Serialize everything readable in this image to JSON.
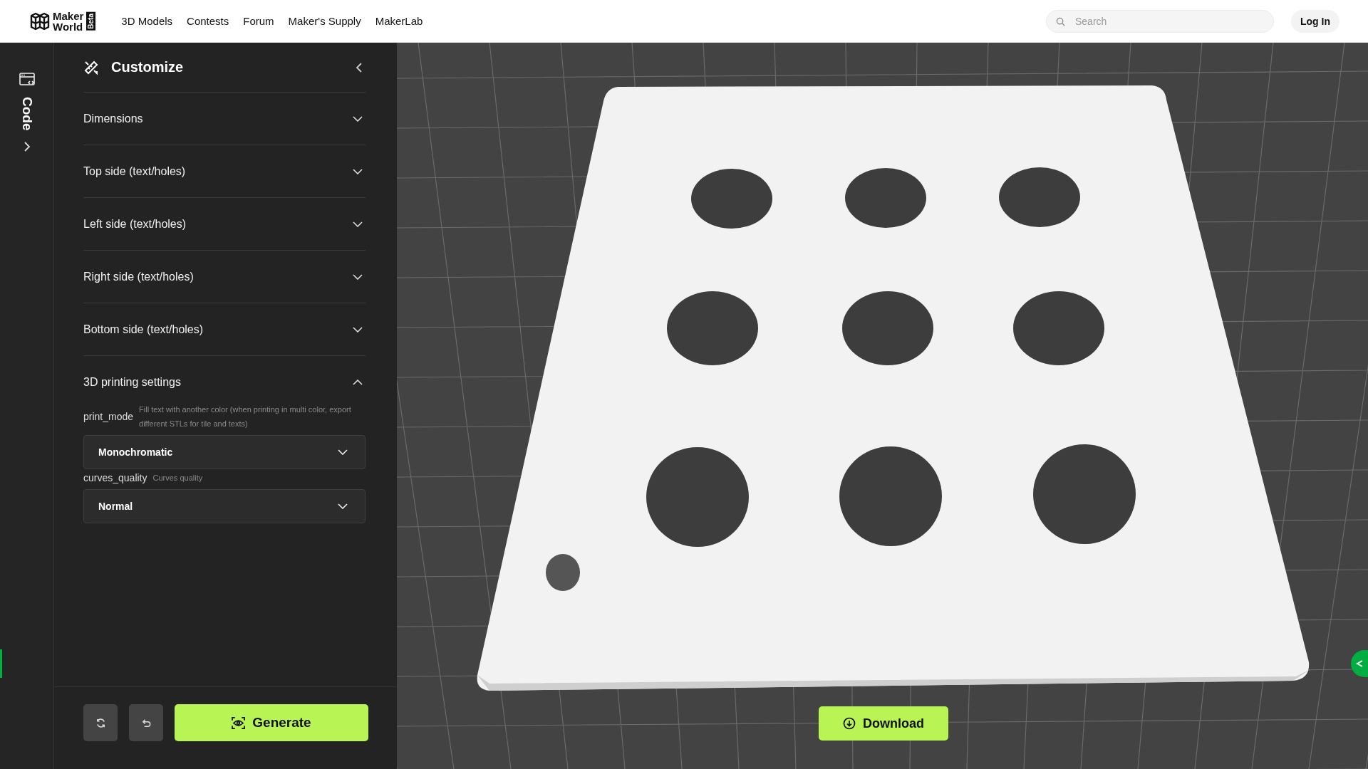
{
  "header": {
    "logo": {
      "line1": "Maker",
      "line2": "World",
      "badge": "Beta"
    },
    "nav": [
      "3D Models",
      "Contests",
      "Forum",
      "Maker's Supply",
      "MakerLab"
    ],
    "search": {
      "placeholder": "Search"
    },
    "login": "Log In"
  },
  "rail": {
    "label": "Code"
  },
  "panel": {
    "title": "Customize",
    "sections": [
      {
        "label": "Dimensions",
        "expanded": false
      },
      {
        "label": "Top side (text/holes)",
        "expanded": false
      },
      {
        "label": "Left side (text/holes)",
        "expanded": false
      },
      {
        "label": "Right side (text/holes)",
        "expanded": false
      },
      {
        "label": "Bottom side (text/holes)",
        "expanded": false
      },
      {
        "label": "3D printing settings",
        "expanded": true,
        "params": [
          {
            "name": "print_mode",
            "hint": "Fill text with another color (when printing in multi color, export different STLs for tile and texts)",
            "value": "Monochromatic"
          },
          {
            "name": "curves_quality",
            "hint": "Curves quality",
            "value": "Normal"
          }
        ]
      }
    ],
    "generate": "Generate"
  },
  "viewport": {
    "kind": "picture",
    "download": "Download"
  }
}
